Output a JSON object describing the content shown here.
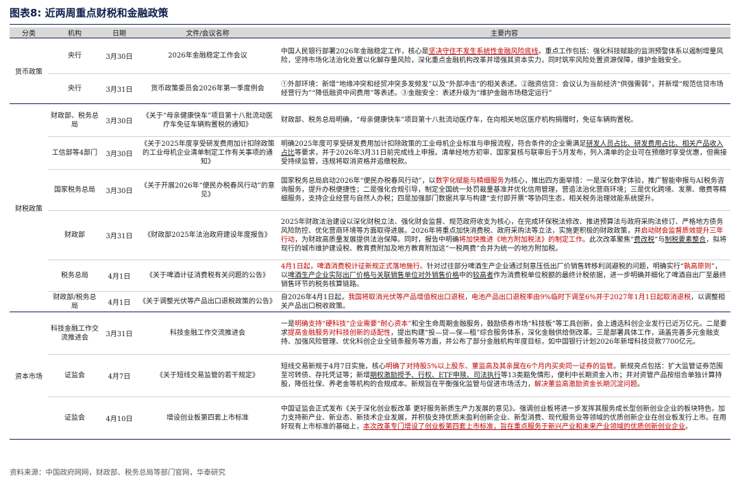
{
  "title": "图表8:  近两周重点财税和金融政策",
  "header": {
    "cat": "分类",
    "org": "机构",
    "date": "日期",
    "doc": "文件/会议名称",
    "content": "主要内容"
  },
  "categories": {
    "c1": "货币政策",
    "c2": "财税政策",
    "c3": "资本市场"
  },
  "rows": [
    {
      "org": "央行",
      "date": "3月30日",
      "doc": "2026年金融稳定工作会议",
      "c": [
        "中国人民银行部署2026年金融稳定工作，核心是",
        "坚决守住不发生系统性金融风险底线",
        "。重点工作包括：强化科技赋能的监测预警体系以遏制增量风险，坚持市场化法治化处置以化解存量风险，深化重点金融机构改革并增强其资本实力，同时筑牢风险处置资源保障，维护金融安全。"
      ]
    },
    {
      "org": "央行",
      "date": "3月31日",
      "doc": "货币政策委员会2026年第一季度例会",
      "c": [
        "①外部环境：新增“地缘冲突和经贸冲突多发频发”以及“外部冲击”的相关表述。②融资信贷：会议认为当前经济“供强需弱”，并新增“规范信贷市场经营行为”“降低融资中间费用”等表述。③金融安全：表述升级为“维护金融市场稳定运行”"
      ]
    },
    {
      "org": "财政部、税务总局",
      "date": "3月30日",
      "doc": "《关于“母亲健康快车”项目第十八批流动医疗车免征车辆购置税的通知》",
      "c": [
        "财政部、税务总局明确，“母亲健康快车”项目第十八批流动医疗车，在向相关地区医疗机构捐赠时，免征车辆购置税。"
      ]
    },
    {
      "org": "工信部等4部门",
      "date": "3月30日",
      "doc": "《关于2025年度享受研发费用加计扣除政策的工业母机企业清单制定工作有关事项的通知》",
      "c": [
        "明确2025年度可享受研发费用加计扣除政策的工业母机企业标准与申报流程，符合条件的企业需满足",
        "研发人员占比、研发费用占比、相关产品收入占比",
        "等要求，并于2026年3月31日前完成线上申报。清单经地方初审、国家复核与联审后于5月发布，列入清单的企业可在预缴时享受优惠，但需接受持续监管，违规将取消资格并追缴税款。"
      ]
    },
    {
      "org": "国家税务总局",
      "date": "3月30日",
      "doc": "《关于开展2026年“便民办税春风行动”的意见》",
      "c": [
        "国家税务总局启动2026年“便民办税春风行动”，以",
        "数字化赋能与精细服务",
        "为核心，推出四方面举措：一是深化数字体验，推广智能申报与AI税务咨询服务，提升办税便捷性；二是强化合规引导，制定全国统一处罚裁量基准并优化信用管理，营造法治化营商环境；三是优化跨境、发票、缴费等精细服务，支持企业经营与自然人办税；四是加强部门数据共享与构建“支付即开票”等协同生态，相关税务治理效能系统提升。"
      ]
    },
    {
      "org": "财政部",
      "date": "3月31日",
      "doc": "《财政部2025年法治政府建设年度报告》",
      "c": [
        "2025年财政法治建设以深化财税立法、强化财会监督、规范政府收支为核心，在完成环保税法修改、推进预算法与政府采购法修订、严格地方债务风险防控、优化营商环境等方面取得进展。2026年将重点加快消费税、政府采购法等立法，实施更积极的财政政策，并",
        "启动财会监督质效提升三年行动",
        "，为财政高质量发展提供法治保障。同时，报告中明确",
        "将加快推进《地方附加税法》的制定工作",
        "。此次改革聚焦“",
        "费改税",
        "”与",
        "制税要素整合",
        "，拟将现行的城市维护建设税、教育费附加及地方教育附加这“一税两费”合并为统一的地方附加税。"
      ]
    },
    {
      "org": "税务总局",
      "date": "4月1日",
      "doc": "《关于啤酒计征消费税有关问题的公告》",
      "c": [
        "4月1日起，啤酒消费税计征新规正式落地施行。",
        "针对过往部分啤酒生产企业通过刻意压低出厂价销售转移利润避税的问题，明确实行“",
        "孰高原则",
        "”，以",
        "啤酒生产企业实际出厂价格与关联销售单位对外销售价格",
        "中的",
        "较高者",
        "作为消费税单位税额的最终计税依据，进一步明确并细化了啤酒自出厂至最终销售环节的税务核算链路。"
      ]
    },
    {
      "org": "财政部/税务总局",
      "date": "4月1日",
      "doc": "《关于调整光伏等产品出口退税政策的公告》",
      "c": [
        "自2026年4月1日起，",
        "我国将取消光伏等产品增值税出口退税，电池产品出口退税率由9%临时下调至6%并于2027年1月1日起取消退税",
        "，以调整相关产品出口税收政策。"
      ]
    },
    {
      "org": "科技金融工作交流推进会",
      "date": "3月31日",
      "doc": "科技金融工作交流推进会",
      "c": [
        "一是",
        "明确支持“硬科技”企业需要“耐心资本”",
        "和全生命周期金融服务，鼓励债券市场“科技板”等工具创新，会上遴选科创企业发行已近万亿元。二是要求",
        "提高金融服务对科技创新的适配性",
        "，提出构建“投—贷—保—租”综合服务体系，深化金融供给侧改革。三是部署具体工作，涵盖完善多元金融支持、加强风险管理、优化科创企业全链条服务等方面，并公布了部分金融机构年度目标，如中国银行计划2026年新增科技贷款7700亿元。"
      ]
    },
    {
      "org": "证监会",
      "date": "4月7日",
      "doc": "《关于短线交易监管的若干规定》",
      "c": [
        "短线交易新规于4月7日实施，核心",
        "明确了对持股5%以上股东、董监高及其亲属在6个月内买卖同一证券的监管",
        "。新规亮点包括：扩大监管证券范围至可转债、存托凭证等；新增",
        "期权激励授予、行权、ETF申赎、司法执行",
        "等13类豁免情形，便利中长期资金入市；并对资管产品按组合单独计算持股，降低社保、养老金等机构的合规成本。新规旨在平衡强化监管与促进市场活力，",
        "解决董监高激励资金长期沉淀问题",
        "。"
      ]
    },
    {
      "org": "证监会",
      "date": "4月10日",
      "doc": "增设创业板第四套上市标准",
      "c": [
        "中国证监会正式发布《关于深化创业板改革 更好服务新质生产力发展的意见》。强调创业板将进一步发挥其服务成长型创新创业企业的板块特色，加力支持新产业、新业态、新技术企业发展，并积极支持优质未盈利创新企业、新型消费、现代服务业等领域的优质创新企业在创业板发行上市。在用好现有上市标准的基础上，",
        "本次改革专门增设了创业板第四套上市标准，旨在重点服务于新兴产业和未来产业领域的优质创新创业企业",
        "。"
      ]
    }
  ],
  "source": "资料来源：中国政府网网，财政部、税务总局等部门官网，华泰研究"
}
